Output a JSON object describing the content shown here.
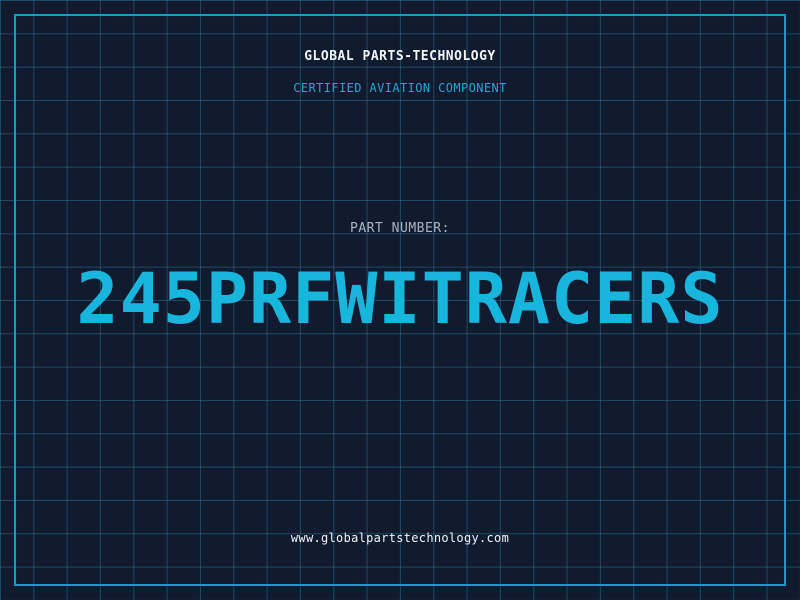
{
  "header": {
    "company_name": "GLOBAL PARTS-TECHNOLOGY",
    "tagline": "CERTIFIED AVIATION COMPONENT"
  },
  "part": {
    "label": "PART NUMBER:",
    "number": "245PRFWITRACERS"
  },
  "footer": {
    "website": "www.globalpartstechnology.com"
  },
  "colors": {
    "background": "#111b30",
    "grid": "#286e8c",
    "frame": "#1a9ac4",
    "accent": "#18b6dc",
    "tagline": "#2aa2d2",
    "text": "#f2f4f8",
    "label": "#aab5c4"
  }
}
